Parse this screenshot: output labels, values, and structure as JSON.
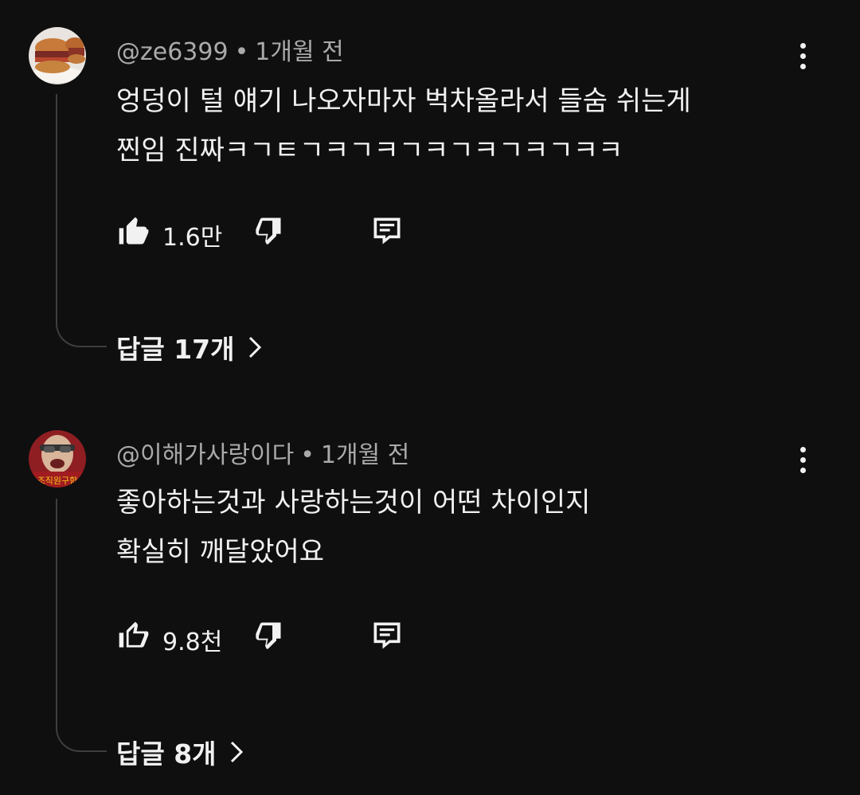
{
  "comments": [
    {
      "author": "@ze6399",
      "time": "1개월 전",
      "text_lines": [
        "엉덩이 털 얘기 나오자마자 벅차올라서 들숨 쉬는게",
        "찐임 진짜ㅋㄱㅌㄱㅋㄱㅋㄱㅋㄱㅋㄱㅋㄱㅋㅋ"
      ],
      "likes": "1.6만",
      "liked": true,
      "replies_label": "답글 17개",
      "avatar_icon": "burger-avatar"
    },
    {
      "author": "@이해가사랑이다",
      "time": "1개월 전",
      "text_lines": [
        "좋아하는것과 사랑하는것이  어떤 차이인지",
        "확실히 깨달았어요"
      ],
      "likes": "9.8천",
      "liked": false,
      "replies_label": "답글 8개",
      "avatar_icon": "person-avatar",
      "avatar_caption": "조직원구함"
    }
  ],
  "colors": {
    "background": "#0f0f0f",
    "text": "#f1f1f1",
    "meta": "#aaaaaa",
    "thread": "#3e3e3e"
  }
}
